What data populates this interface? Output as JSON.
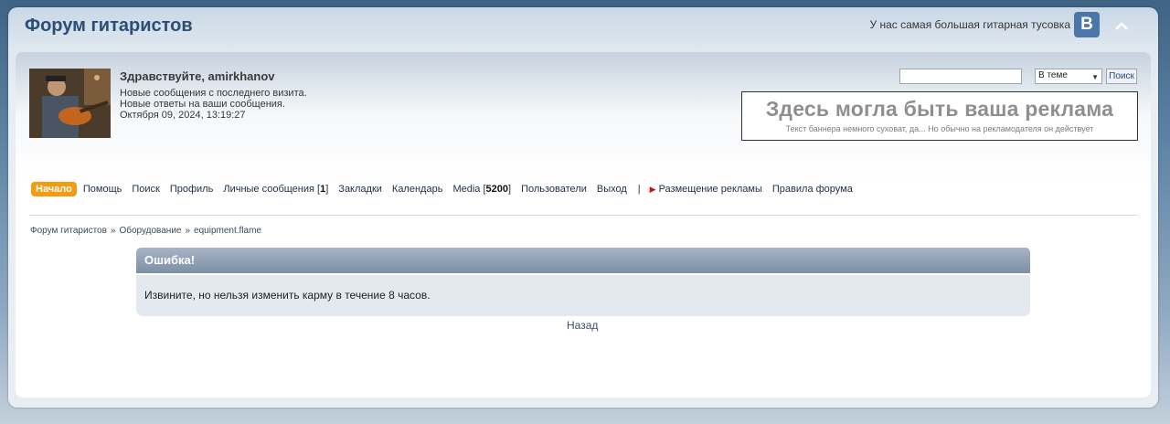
{
  "header": {
    "title": "Форум гитаристов",
    "tagline": "У нас самая большая гитарная тусовка",
    "vk_label": "B"
  },
  "user": {
    "greeting": "Здравствуйте, amirkhanov",
    "new_posts": "Новые сообщения с последнего визита.",
    "new_replies": "Новые ответы на ваши сообщения.",
    "datetime": "Октября 09, 2024, 13:19:27"
  },
  "search": {
    "input_value": "",
    "scope_selected": "В теме",
    "button_label": "Поиск"
  },
  "ad": {
    "title": "Здесь могла быть ваша реклама",
    "subtitle": "Текст баннера немного суховат, да... Но обычно на рекламодателя он действует"
  },
  "nav": {
    "home": "Начало",
    "help": "Помощь",
    "search": "Поиск",
    "profile": "Профиль",
    "messages": "Личные сообщения",
    "messages_count": "1",
    "bookmarks": "Закладки",
    "calendar": "Календарь",
    "media": "Media",
    "media_count": "5200",
    "users": "Пользователи",
    "logout": "Выход",
    "separator": "|",
    "advertising": "Размещение рекламы",
    "rules": "Правила форума"
  },
  "breadcrumb": {
    "items": [
      "Форум гитаристов",
      "Оборудование",
      "equipment.flame"
    ],
    "separator": "»"
  },
  "error": {
    "title": "Ошибка!",
    "message": "Извините, но нельзя изменить карму в течение 8 часов."
  },
  "back_link": "Назад"
}
